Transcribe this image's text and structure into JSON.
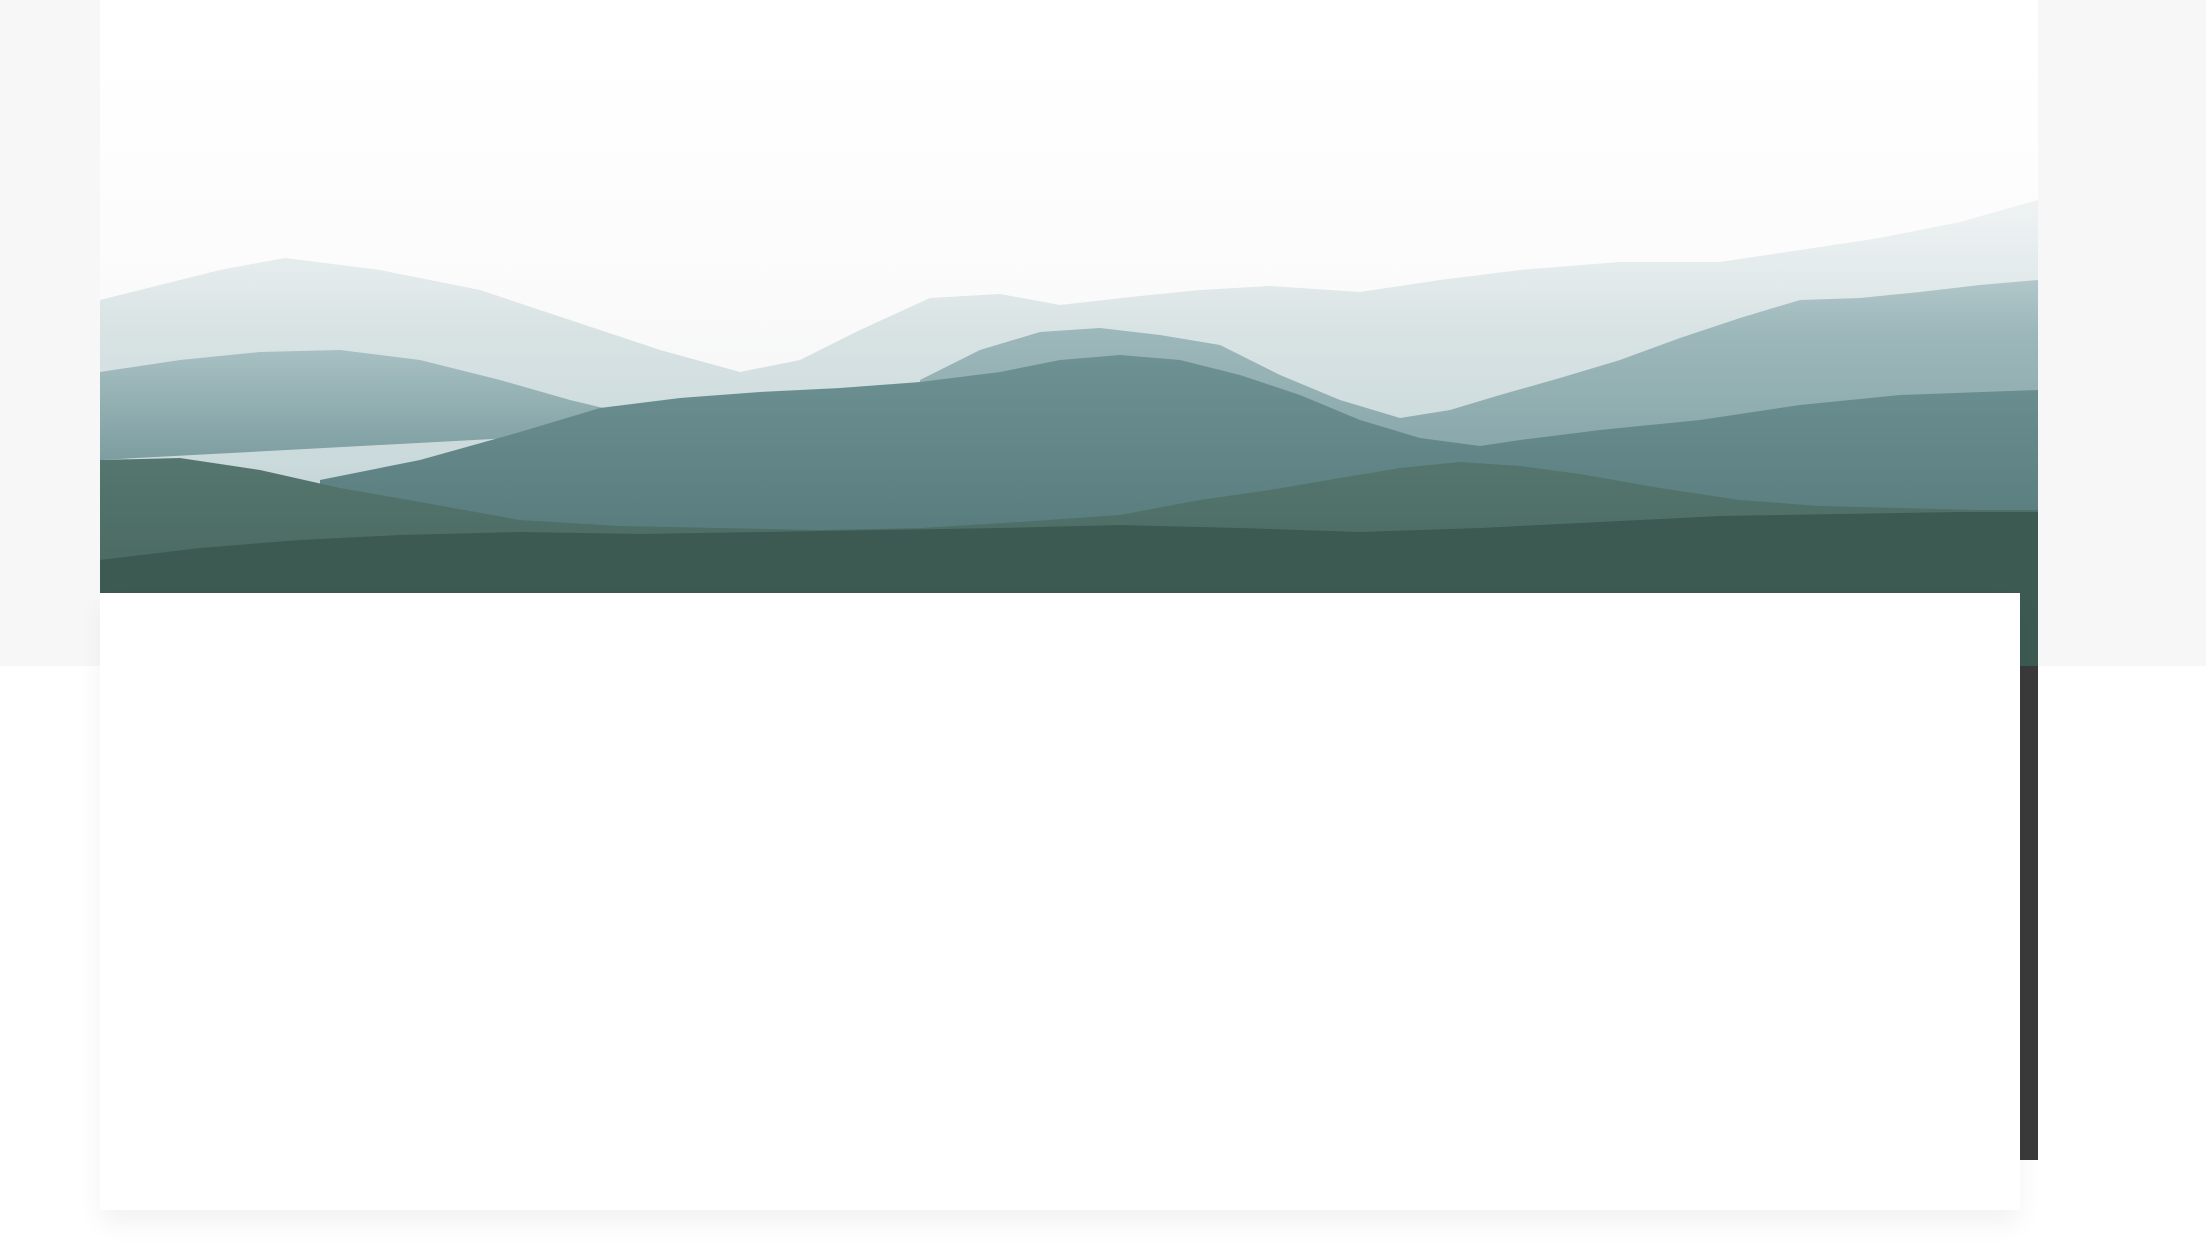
{
  "page": {
    "background": "#ffffff",
    "band_color": "#f7f7f7"
  },
  "hero": {
    "image": "misty-mountain-landscape",
    "palette": {
      "sky_top": "#ffffff",
      "sky_mist": "#f3f3f3",
      "far_ridge": "#b9cdd0",
      "mid_ridge": "#7fa0a4",
      "near_ridge": "#5a7e80",
      "forest": "#47685f",
      "forest_dark": "#3c5a52"
    }
  },
  "content_card": {
    "color": "#ffffff"
  },
  "scrollbar_strip": {
    "color": "#3a3a3a"
  }
}
